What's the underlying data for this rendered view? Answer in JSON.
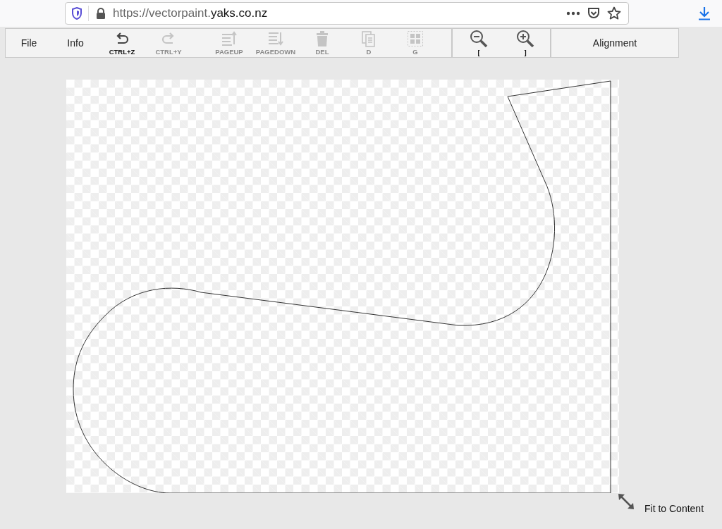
{
  "browser": {
    "url_prefix": "https://vectorpaint.",
    "url_domain": "yaks.co.nz"
  },
  "toolbar": {
    "menus": [
      "File",
      "Info"
    ],
    "tools": [
      {
        "kind": "undo",
        "label": "CTRL+Z",
        "disabled": false
      },
      {
        "kind": "redo",
        "label": "CTRL+Y",
        "disabled": true
      },
      {
        "kind": "pageup",
        "label": "PAGEUP",
        "disabled": true
      },
      {
        "kind": "pagedown",
        "label": "PAGEDOWN",
        "disabled": true
      },
      {
        "kind": "delete",
        "label": "DEL",
        "disabled": true
      },
      {
        "kind": "duplicate",
        "label": "D",
        "disabled": true
      },
      {
        "kind": "group",
        "label": "G",
        "disabled": true
      }
    ],
    "zoom": [
      {
        "kind": "zoom-out",
        "label": "["
      },
      {
        "kind": "zoom-in",
        "label": "]"
      }
    ],
    "alignment": "Alignment"
  },
  "canvas": {
    "fit_label": "Fit to Content"
  }
}
